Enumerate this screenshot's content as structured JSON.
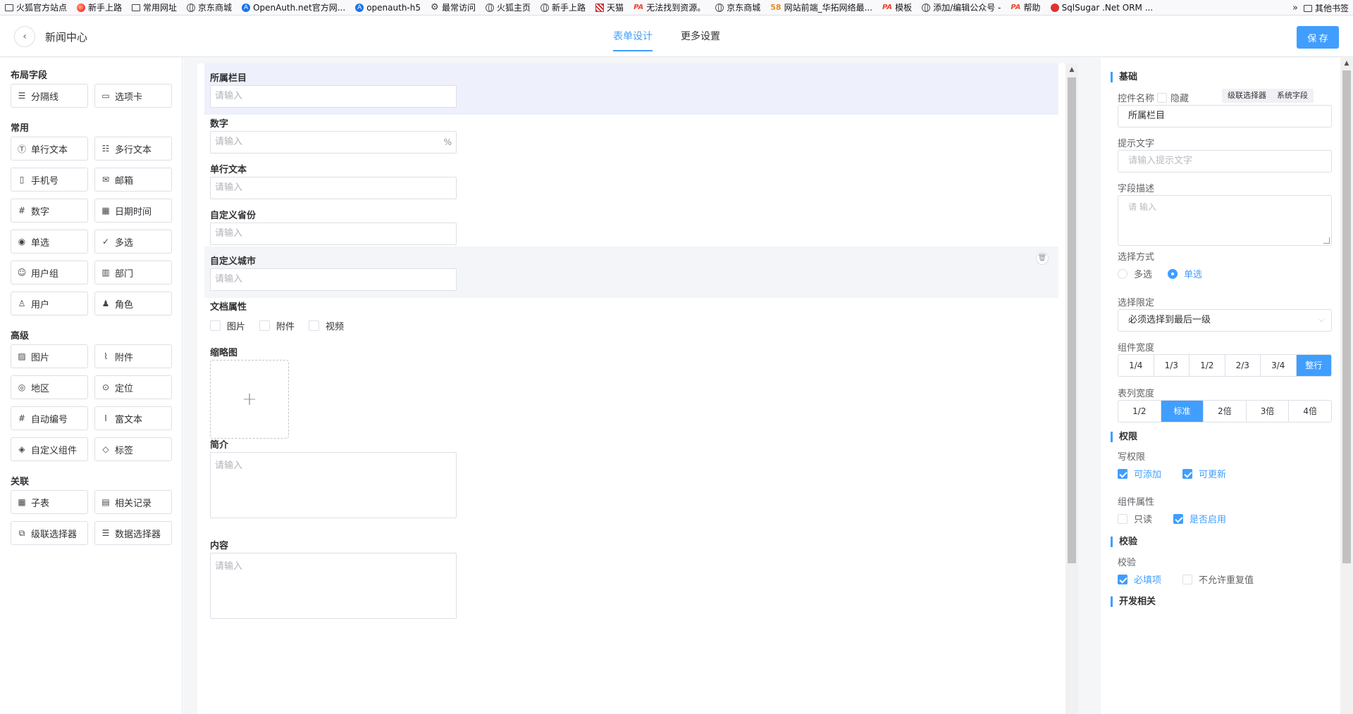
{
  "bookmarks": [
    {
      "label": "火狐官方站点",
      "icon": "folder-icon"
    },
    {
      "label": "新手上路",
      "icon": "firefox-icon"
    },
    {
      "label": "常用网址",
      "icon": "folder-icon"
    },
    {
      "label": "京东商城",
      "icon": "globe-icon"
    },
    {
      "label": "OpenAuth.net官方网...",
      "icon": "openauth-icon"
    },
    {
      "label": "openauth-h5",
      "icon": "openauth-icon"
    },
    {
      "label": "最常访问",
      "icon": "gear-icon"
    },
    {
      "label": "火狐主页",
      "icon": "globe-icon"
    },
    {
      "label": "新手上路",
      "icon": "globe-icon"
    },
    {
      "label": "天猫",
      "icon": "tmall-icon"
    },
    {
      "label": "无法找到资源。",
      "icon": "pa-icon"
    },
    {
      "label": "京东商城",
      "icon": "globe-icon"
    },
    {
      "label": "网站前端_华拓网络最...",
      "icon": "58-icon"
    },
    {
      "label": "模板",
      "icon": "pa-icon"
    },
    {
      "label": "添加/编辑公众号 -",
      "icon": "globe-icon"
    },
    {
      "label": "帮助",
      "icon": "pa-icon"
    },
    {
      "label": "SqlSugar .Net ORM ...",
      "icon": "sqlsugar-icon"
    }
  ],
  "bookmarks_more": "»",
  "bookmarks_other": "其他书签",
  "header": {
    "back": "‹",
    "title": "新闻中心",
    "tabs": [
      {
        "label": "表单设计",
        "active": true
      },
      {
        "label": "更多设置",
        "active": false
      }
    ],
    "save": "保 存"
  },
  "palette": {
    "groups": [
      {
        "title": "布局字段",
        "items": [
          {
            "label": "分隔线",
            "glyph": "☰"
          },
          {
            "label": "选项卡",
            "glyph": "▭"
          }
        ]
      },
      {
        "title": "常用",
        "items": [
          {
            "label": "单行文本",
            "glyph": "Ⓣ"
          },
          {
            "label": "多行文本",
            "glyph": "☷"
          },
          {
            "label": "手机号",
            "glyph": "▯"
          },
          {
            "label": "邮箱",
            "glyph": "✉"
          },
          {
            "label": "数字",
            "glyph": "#"
          },
          {
            "label": "日期时间",
            "glyph": "▦"
          },
          {
            "label": "单选",
            "glyph": "◉"
          },
          {
            "label": "多选",
            "glyph": "✓"
          },
          {
            "label": "用户组",
            "glyph": "☺"
          },
          {
            "label": "部门",
            "glyph": "▥"
          },
          {
            "label": "用户",
            "glyph": "♙"
          },
          {
            "label": "角色",
            "glyph": "♟"
          }
        ]
      },
      {
        "title": "高级",
        "items": [
          {
            "label": "图片",
            "glyph": "▨"
          },
          {
            "label": "附件",
            "glyph": "⌇"
          },
          {
            "label": "地区",
            "glyph": "◎"
          },
          {
            "label": "定位",
            "glyph": "⊙"
          },
          {
            "label": "自动编号",
            "glyph": "#"
          },
          {
            "label": "富文本",
            "glyph": "Ⅰ"
          },
          {
            "label": "自定义组件",
            "glyph": "◈"
          },
          {
            "label": "标签",
            "glyph": "◇"
          }
        ]
      },
      {
        "title": "关联",
        "items": [
          {
            "label": "子表",
            "glyph": "▦"
          },
          {
            "label": "相关记录",
            "glyph": "▤"
          },
          {
            "label": "级联选择器",
            "glyph": "⧉"
          },
          {
            "label": "数据选择器",
            "glyph": "☰"
          }
        ]
      }
    ]
  },
  "canvas": {
    "fields": [
      {
        "label": "所属栏目",
        "placeholder": "请输入"
      },
      {
        "label": "数字",
        "placeholder": "请输入",
        "suffix": "%"
      },
      {
        "label": "单行文本",
        "placeholder": "请输入"
      },
      {
        "label": "自定义省份",
        "placeholder": "请输入"
      },
      {
        "label": "自定义城市",
        "placeholder": "请输入"
      }
    ],
    "doc_attr": {
      "label": "文档属性",
      "options": [
        "图片",
        "附件",
        "视频"
      ]
    },
    "thumb": {
      "label": "缩略图",
      "plus": "+"
    },
    "summary": {
      "label": "简介",
      "placeholder": "请输入"
    },
    "content": {
      "label": "内容",
      "placeholder": "请输入"
    },
    "delete_glyph": "🗑"
  },
  "props": {
    "basic": "基础",
    "ctrl_name_label": "控件名称",
    "hide_label": "隐藏",
    "cascade_btn": "级联选择器",
    "sys_btn": "系统字段",
    "ctrl_name_value": "所属栏目",
    "hint_label": "提示文字",
    "hint_placeholder": "请输入提示文字",
    "desc_label": "字段描述",
    "desc_placeholder": "请 输入",
    "select_mode_label": "选择方式",
    "select_mode": [
      {
        "label": "多选",
        "on": false
      },
      {
        "label": "单选",
        "on": true
      }
    ],
    "select_limit_label": "选择限定",
    "select_limit_value": "必须选择到最后一级",
    "width_label": "组件宽度",
    "widths": [
      {
        "label": "1/4",
        "on": false
      },
      {
        "label": "1/3",
        "on": false
      },
      {
        "label": "1/2",
        "on": false
      },
      {
        "label": "2/3",
        "on": false
      },
      {
        "label": "3/4",
        "on": false
      },
      {
        "label": "整行",
        "on": true
      }
    ],
    "col_width_label": "表列宽度",
    "col_widths": [
      {
        "label": "1/2",
        "on": false
      },
      {
        "label": "标准",
        "on": true
      },
      {
        "label": "2倍",
        "on": false
      },
      {
        "label": "3倍",
        "on": false
      },
      {
        "label": "4倍",
        "on": false
      }
    ],
    "perm": "权限",
    "write_label": "写权限",
    "write_opts": [
      {
        "label": "可添加",
        "on": true
      },
      {
        "label": "可更新",
        "on": true
      }
    ],
    "attr_label": "组件属性",
    "attr_opts": [
      {
        "label": "只读",
        "on": false
      },
      {
        "label": "是否启用",
        "on": true
      }
    ],
    "verify": "校验",
    "verify_label": "校验",
    "verify_opts": [
      {
        "label": "必填项",
        "on": true
      },
      {
        "label": "不允许重复值",
        "on": false
      }
    ],
    "dev": "开发相关"
  },
  "colors": {
    "accent": "#409eff",
    "border": "#dcdfe6",
    "selected_bg": "#eef1fb"
  }
}
